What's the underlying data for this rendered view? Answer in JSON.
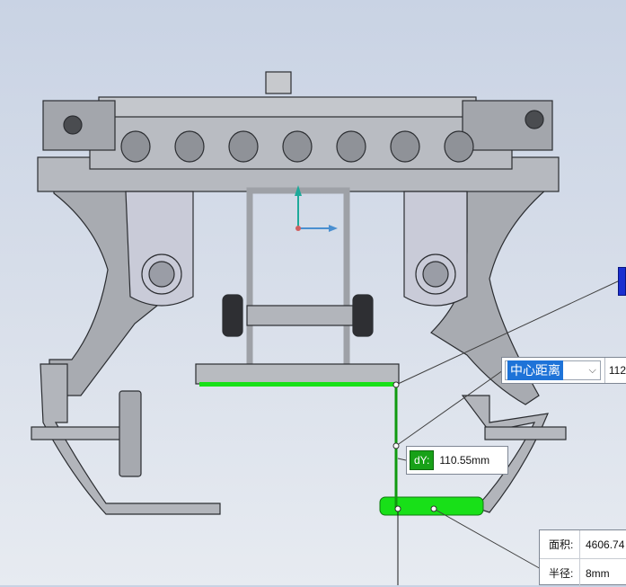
{
  "colors": {
    "background_top": "#c9d3e4",
    "part_fill": "#a8abb1",
    "part_stroke": "#2b2d31",
    "highlight_green": "#18e018",
    "dimension_green": "#0f9a0f",
    "select_blue": "#1e73d8",
    "marker_blue": "#1a2fd0"
  },
  "icons": {
    "triad": "coordinate-triad-icon",
    "dropdown": "chevron-down-icon"
  },
  "dimension": {
    "dy_label": "dY:",
    "dy_value": "110.55mm"
  },
  "measure": {
    "mode_label": "中心距离",
    "mode_value": "112"
  },
  "properties": {
    "area_label": "面积:",
    "area_value": "4606.74",
    "radius_label": "半径:",
    "radius_value": "8mm"
  }
}
